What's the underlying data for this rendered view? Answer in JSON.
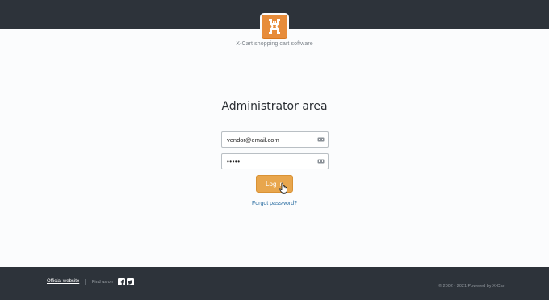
{
  "header": {
    "tagline": "X-Cart shopping cart software"
  },
  "icons": {
    "logo": "x-cart-logo-icon",
    "field_key": "credential-key-icon",
    "cursor": "hand-pointer-icon",
    "facebook": "facebook-icon",
    "twitter": "twitter-icon"
  },
  "colors": {
    "brand_orange": "#e78c3a",
    "button": "#e8a64d",
    "bars": "#2d333a",
    "link": "#2d6fa3"
  },
  "login": {
    "title": "Administrator area",
    "email_value": "vendor@email.com",
    "password_value": "•••••",
    "button_label": "Log in",
    "forgot_label": "Forgot password?"
  },
  "footer": {
    "official_label": "Official website",
    "find_us_label": "Find us on",
    "copyright": "© 2002 - 2021 Powered by X-Cart"
  }
}
